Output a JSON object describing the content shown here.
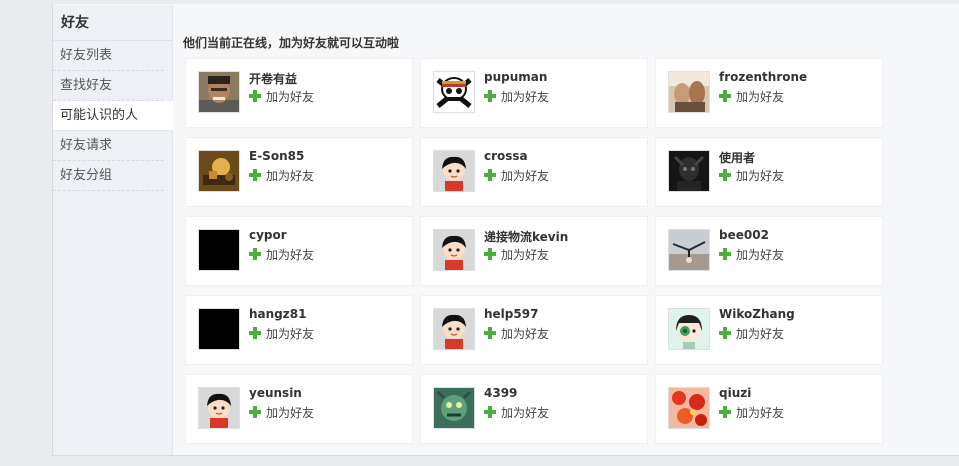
{
  "sidebar": {
    "title": "好友",
    "items": [
      {
        "label": "好友列表",
        "active": false
      },
      {
        "label": "查找好友",
        "active": false
      },
      {
        "label": "可能认识的人",
        "active": true
      },
      {
        "label": "好友请求",
        "active": false
      },
      {
        "label": "好友分组",
        "active": false
      }
    ]
  },
  "main": {
    "heading": "他们当前正在线，加为好友就可以互动啦",
    "add_friend_label": "加为好友",
    "users": [
      {
        "name": "开卷有益",
        "avatar": "photo-man-avatar"
      },
      {
        "name": "pupuman",
        "avatar": "skull-pirate-avatar"
      },
      {
        "name": "frozenthrone",
        "avatar": "photo-people-avatar"
      },
      {
        "name": "E-Son85",
        "avatar": "photo-golden-scene-avatar"
      },
      {
        "name": "crossa",
        "avatar": "default-cartoon-avatar"
      },
      {
        "name": "使用者",
        "avatar": "dark-figure-avatar"
      },
      {
        "name": "cypor",
        "avatar": "black-square-avatar"
      },
      {
        "name": "递接物流kevin",
        "avatar": "default-cartoon-avatar"
      },
      {
        "name": "bee002",
        "avatar": "photo-landscape-avatar"
      },
      {
        "name": "hangz81",
        "avatar": "black-square-avatar"
      },
      {
        "name": "help597",
        "avatar": "default-cartoon-avatar"
      },
      {
        "name": "WikoZhang",
        "avatar": "anime-girl-avatar"
      },
      {
        "name": "yeunsin",
        "avatar": "default-cartoon-avatar"
      },
      {
        "name": "4399",
        "avatar": "green-monster-avatar"
      },
      {
        "name": "qiuzi",
        "avatar": "red-flowers-avatar"
      }
    ]
  },
  "colors": {
    "plus_icon": "#4caf3c",
    "page_bg": "#e9ebee",
    "sidebar_bg": "#edf1f6"
  }
}
